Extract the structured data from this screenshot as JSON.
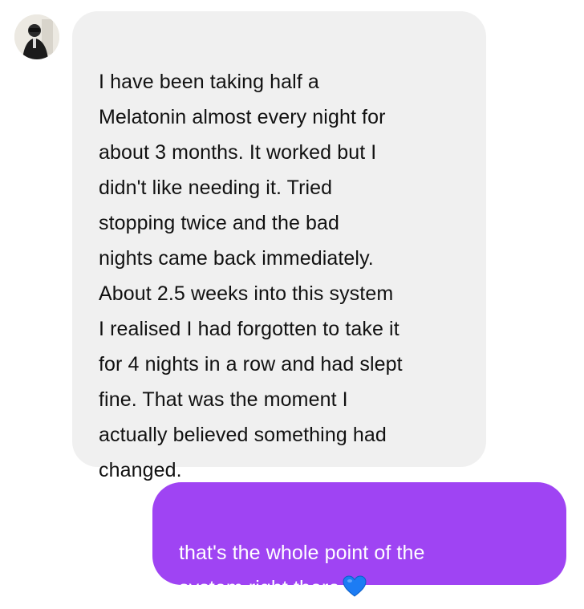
{
  "conversation": {
    "contact": {
      "avatar_icon": "user-avatar-icon"
    },
    "messages": [
      {
        "direction": "incoming",
        "text": "I have been taking half a\nMelatonin almost every night for\nabout 3 months. It worked but I\ndidn't like needing it. Tried\nstopping twice and the bad\nnights came back immediately.\nAbout 2.5 weeks into this system\nI realised I had forgotten to take it\nfor 4 nights in a row and had slept\nfine. That was the moment I\nactually believed something had\nchanged."
      },
      {
        "direction": "outgoing",
        "text": "that's the whole point of the\nsystem right there",
        "emoji_icon": "blue-heart-icon"
      }
    ]
  },
  "colors": {
    "incoming_bubble": "#f0f0f0",
    "outgoing_bubble": "#9f44f3",
    "incoming_text": "#111111",
    "outgoing_text": "#ffffff",
    "heart": "#1c7cf4"
  }
}
